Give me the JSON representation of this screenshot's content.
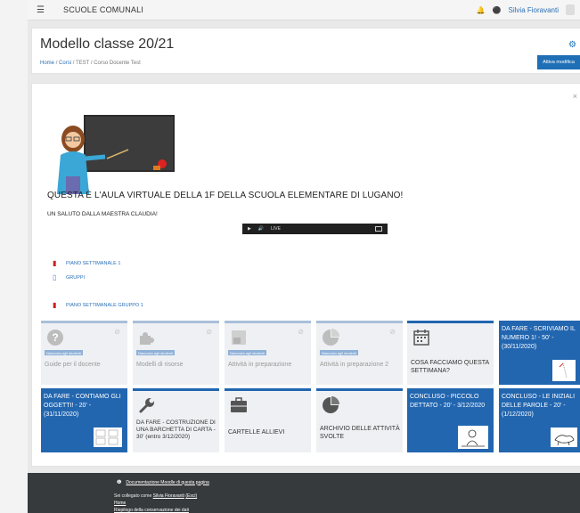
{
  "navbar": {
    "site_name": "SCUOLE COMUNALI",
    "user_name": "Silvia Fioravanti"
  },
  "header": {
    "title": "Modello classe 20/21",
    "breadcrumb": [
      "Home",
      "Corsi",
      "TEST",
      "Corso Docente Test"
    ],
    "edit_button": "Attiva modifica"
  },
  "main": {
    "welcome": "QUESTA È L'AULA VIRTUALE DELLA 1F DELLA SCUOLA ELEMENTARE DI LUGANO!",
    "greeting": "UN SALUTO DALLA MAESTRA CLAUDIA!",
    "player_live": "LIVE",
    "resources": [
      {
        "label": "PIANO SETTIMANALE 1",
        "icon": "pdf-icon"
      },
      {
        "label": "GRUPPI",
        "icon": "folder-icon"
      },
      {
        "label": "PIANO SETTIMANALE GRUPPO 1",
        "icon": "pdf-icon"
      }
    ],
    "tiles_row1": [
      {
        "label": "Guide per il docente",
        "badge": "Nascosta agli studenti",
        "icon": "question-icon"
      },
      {
        "label": "Modelli di risorse",
        "badge": "Nascosta agli studenti",
        "icon": "puzzle-icon"
      },
      {
        "label": "Attività in preparazione",
        "badge": "Nascosta agli studenti",
        "icon": "puzzle-piece-icon"
      },
      {
        "label": "Attività in preparazione 2",
        "badge": "Nascosta agli studenti",
        "icon": "pie-chart-icon"
      },
      {
        "label": "COSA FACCIAMO QUESTA SETTIMANA?",
        "icon": "calendar-icon"
      },
      {
        "label": "DA FARE - SCRIVIAMO IL NUMERO 1! - 50' - (30/11/2020)"
      }
    ],
    "tiles_row2": [
      {
        "label": "DA FARE - CONTIAMO GLI OGGETTI! - 20' - (31/11/2020)"
      },
      {
        "label": "DA FARE - COSTRUZIONE DI UNA BARCHETTA DI CARTA - 30' (entro 3/12/2020)",
        "icon": "wrench-icon"
      },
      {
        "label": "CARTELLE ALLIEVI",
        "icon": "briefcase-icon"
      },
      {
        "label": "ARCHIVIO DELLE ATTIVITÀ SVOLTE",
        "icon": "pie-chart-icon"
      },
      {
        "label": "CONCLUSO - PICCOLO DETTATO - 20' - 3/12/2020"
      },
      {
        "label": "CONCLUSO - LE INIZIALI DELLE PAROLE - 20' - (1/12/2020)"
      }
    ]
  },
  "footer": {
    "doc_link": "Documentazione Moodle di questa pagina",
    "logged_prefix": "Sei collegato come",
    "logged_user": "Silvia Fioravanti",
    "logout": "(Esci)",
    "home": "Home",
    "retention": "Riepilogo della conservazione dei dati"
  },
  "colors": {
    "accent": "#2266b0",
    "footer_bg": "#373a3c",
    "pdf": "#cc1f1f"
  }
}
